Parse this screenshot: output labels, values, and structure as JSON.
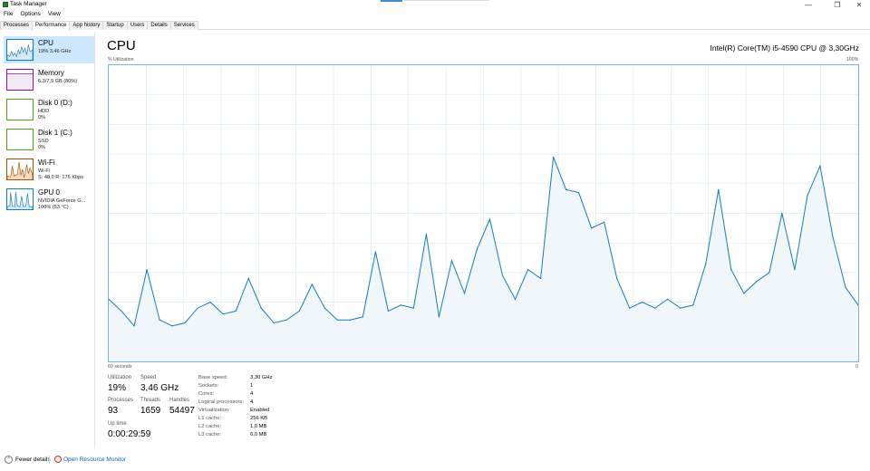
{
  "window": {
    "title": "Task Manager",
    "minimize_glyph": "—",
    "restore_glyph": "❐",
    "close_glyph": "✕"
  },
  "menu": [
    "File",
    "Options",
    "View"
  ],
  "tabs": [
    "Processes",
    "Performance",
    "App history",
    "Startup",
    "Users",
    "Details",
    "Services"
  ],
  "active_tab": "Performance",
  "sidebar": [
    {
      "name": "CPU",
      "sub1": "19% 3,46 GHz",
      "sub2": "",
      "color": "#117dbb",
      "fill": "#f1f6fa",
      "icon": "cpu-thumbnail"
    },
    {
      "name": "Memory",
      "sub1": "6,3/7,9 GB (80%)",
      "sub2": "",
      "color": "#8b12ae",
      "fill": "#f4e8f7",
      "icon": "memory-thumbnail"
    },
    {
      "name": "Disk 0 (D:)",
      "sub1": "HDD",
      "sub2": "0%",
      "color": "#4da60c",
      "fill": "#eef6e8",
      "icon": "disk-thumbnail"
    },
    {
      "name": "Disk 1 (C:)",
      "sub1": "SSD",
      "sub2": "0%",
      "color": "#4da60c",
      "fill": "#eef6e8",
      "icon": "disk-thumbnail"
    },
    {
      "name": "Wi-Fi",
      "sub1": "Wi-Fi",
      "sub2": "S: 48,0  R: 176 Kbps",
      "color": "#a74f01",
      "fill": "#fbeee3",
      "icon": "wifi-thumbnail"
    },
    {
      "name": "GPU 0",
      "sub1": "NVIDIA GeForce G...",
      "sub2": "100% (53 °C)",
      "color": "#117dbb",
      "fill": "#f1f6fa",
      "icon": "gpu-thumbnail"
    }
  ],
  "main": {
    "title": "CPU",
    "model": "Intel(R) Core(TM) i5-4590 CPU @ 3,30GHz",
    "util_label": "% Utilization",
    "max_label": "100%",
    "time_label": "60 seconds",
    "zero_label": "0"
  },
  "stats": {
    "utilization_label": "Utilization",
    "utilization": "19%",
    "speed_label": "Speed",
    "speed": "3,46 GHz",
    "processes_label": "Processes",
    "processes": "93",
    "threads_label": "Threads",
    "threads": "1659",
    "handles_label": "Handles",
    "handles": "54497",
    "uptime_label": "Up time",
    "uptime": "0:00:29:59"
  },
  "details": [
    {
      "key": "Base speed:",
      "value": "3,30 GHz"
    },
    {
      "key": "Sockets:",
      "value": "1"
    },
    {
      "key": "Cores:",
      "value": "4"
    },
    {
      "key": "Logical processors:",
      "value": "4"
    },
    {
      "key": "Virtualization:",
      "value": "Enabled"
    },
    {
      "key": "L1 cache:",
      "value": "256 KB"
    },
    {
      "key": "L2 cache:",
      "value": "1,0 MB"
    },
    {
      "key": "L3 cache:",
      "value": "6,0 MB"
    }
  ],
  "footer": {
    "fewer": "Fewer details",
    "monitor": "Open Resource Monitor"
  },
  "colors": {
    "cpu_line": "#117dbb",
    "cpu_fill": "#f1f6fa",
    "grid": "#d9eaf4",
    "border": "#74b5db",
    "selected": "#cce8ff"
  },
  "chart_data": {
    "type": "area",
    "ylim": [
      0,
      100
    ],
    "x_label": "60 seconds",
    "y_label": "% Utilization",
    "values": [
      21,
      17,
      12,
      31,
      14,
      12,
      13,
      18,
      20,
      16,
      17,
      28,
      18,
      13,
      14,
      17,
      26,
      18,
      14,
      14,
      15,
      37,
      17,
      19,
      18,
      43,
      15,
      34,
      23,
      38,
      48,
      29,
      21,
      31,
      28,
      69,
      58,
      57,
      45,
      47,
      28,
      18,
      20,
      18,
      21,
      18,
      19,
      33,
      58,
      31,
      23,
      27,
      30,
      50,
      31,
      56,
      66,
      42,
      25,
      19
    ]
  }
}
